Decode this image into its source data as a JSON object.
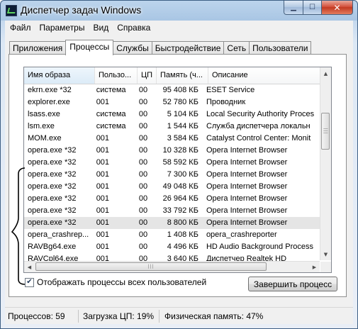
{
  "window": {
    "title": "Диспетчер задач Windows",
    "buttons": {
      "minimize": "▁",
      "maximize": "☐",
      "close": "✕"
    }
  },
  "menu": [
    "Файл",
    "Параметры",
    "Вид",
    "Справка"
  ],
  "tabs": [
    "Приложения",
    "Процессы",
    "Службы",
    "Быстродействие",
    "Сеть",
    "Пользователи"
  ],
  "active_tab": "Процессы",
  "columns": [
    "Имя образа",
    "Пользо...",
    "ЦП",
    "Память (ч...",
    "Описание"
  ],
  "rows": [
    {
      "name": "ekrn.exe *32",
      "user": "система",
      "cpu": "00",
      "mem": "95 408 КБ",
      "desc": "ESET Service"
    },
    {
      "name": "explorer.exe",
      "user": "001",
      "cpu": "00",
      "mem": "52 780 КБ",
      "desc": "Проводник"
    },
    {
      "name": "lsass.exe",
      "user": "система",
      "cpu": "00",
      "mem": "5 104 КБ",
      "desc": "Local Security Authority Proces"
    },
    {
      "name": "lsm.exe",
      "user": "система",
      "cpu": "00",
      "mem": "1 544 КБ",
      "desc": "Служба диспетчера локальн"
    },
    {
      "name": "MOM.exe",
      "user": "001",
      "cpu": "00",
      "mem": "3 584 КБ",
      "desc": "Catalyst Control Center: Monit"
    },
    {
      "name": "opera.exe *32",
      "user": "001",
      "cpu": "00",
      "mem": "10 328 КБ",
      "desc": "Opera Internet Browser"
    },
    {
      "name": "opera.exe *32",
      "user": "001",
      "cpu": "00",
      "mem": "58 592 КБ",
      "desc": "Opera Internet Browser"
    },
    {
      "name": "opera.exe *32",
      "user": "001",
      "cpu": "00",
      "mem": "7 300 КБ",
      "desc": "Opera Internet Browser"
    },
    {
      "name": "opera.exe *32",
      "user": "001",
      "cpu": "00",
      "mem": "49 048 КБ",
      "desc": "Opera Internet Browser"
    },
    {
      "name": "opera.exe *32",
      "user": "001",
      "cpu": "00",
      "mem": "26 964 КБ",
      "desc": "Opera Internet Browser"
    },
    {
      "name": "opera.exe *32",
      "user": "001",
      "cpu": "00",
      "mem": "33 792 КБ",
      "desc": "Opera Internet Browser"
    },
    {
      "name": "opera.exe *32",
      "user": "001",
      "cpu": "00",
      "mem": "8 800 КБ",
      "desc": "Opera Internet Browser",
      "selected": true
    },
    {
      "name": "opera_crashrep...",
      "user": "001",
      "cpu": "00",
      "mem": "1 408 КБ",
      "desc": "opera_crashreporter"
    },
    {
      "name": "RAVBg64.exe",
      "user": "001",
      "cpu": "00",
      "mem": "4 496 КБ",
      "desc": "HD Audio Background Process"
    },
    {
      "name": "RAVCpl64.exe",
      "user": "001",
      "cpu": "00",
      "mem": "3 640 КБ",
      "desc": "Диспетчер Realtek HD"
    }
  ],
  "show_all_users": {
    "label": "Отображать процессы всех пользователей",
    "checked": true,
    "mark": "✔"
  },
  "end_process_button": "Завершить процесс",
  "status": {
    "processes": "Процессов: 59",
    "cpu": "Загрузка ЦП: 19%",
    "memory": "Физическая память: 47%"
  },
  "scroll_glyphs": {
    "up": "▲",
    "down": "▼",
    "left": "◀",
    "right": "▶",
    "grip": "|||"
  }
}
